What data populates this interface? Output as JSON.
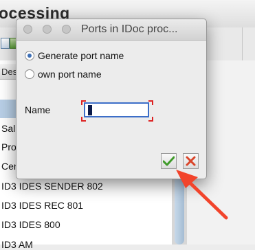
{
  "background": {
    "title": "ocessing",
    "header_label": "Des",
    "rows": [
      "Sal",
      "Pro",
      "Cer",
      "ID3 IDES SENDER 802",
      "ID3 IDES REC 801",
      "ID3 IDES 800",
      "ID3 AM"
    ]
  },
  "dialog": {
    "title": "Ports in IDoc proc...",
    "radio_generate_label": "Generate port name",
    "radio_own_label": "own port name",
    "selected_option": "Generate port name",
    "name_label": "Name",
    "name_value": "",
    "confirm_icon": "checkmark-icon",
    "cancel_icon": "cross-icon"
  },
  "colors": {
    "confirm_green": "#3f9a2a",
    "cancel_red": "#d9452a",
    "annotation_arrow": "#f2442b",
    "input_focus": "#3c6ec8"
  }
}
